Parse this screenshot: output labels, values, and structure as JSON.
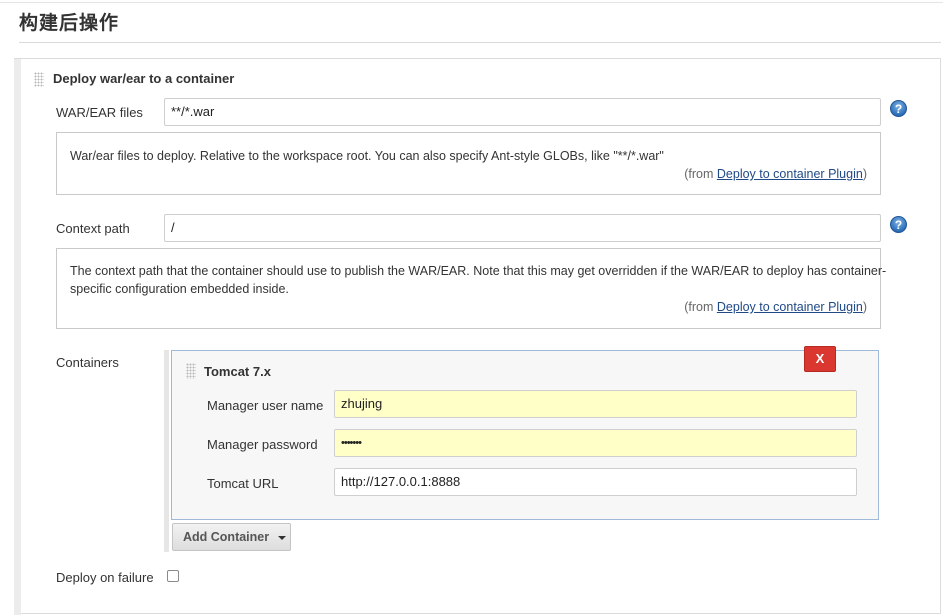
{
  "section": {
    "title": "构建后操作"
  },
  "deploy_block": {
    "title": "Deploy war/ear to a container",
    "war_files": {
      "label": "WAR/EAR files",
      "value": "**/*.war",
      "help_icon": "question-mark",
      "help_text": "War/ear files to deploy. Relative to the workspace root. You can also specify Ant-style GLOBs, like \"**/*.war\"",
      "from_prefix": "(from ",
      "plugin_link": "Deploy to container Plugin",
      "from_suffix": ")"
    },
    "context_path": {
      "label": "Context path",
      "value": "/",
      "help_icon": "question-mark",
      "help_text": "The context path that the container should use to publish the WAR/EAR. Note that this may get overridden if the WAR/EAR to deploy has container-specific configuration embedded inside.",
      "from_prefix": "(from ",
      "plugin_link": "Deploy to container Plugin",
      "from_suffix": ")"
    },
    "containers": {
      "label": "Containers",
      "delete_label": "X",
      "tomcat": {
        "title": "Tomcat 7.x",
        "user_label": "Manager user name",
        "user_value": "zhujing",
        "password_label": "Manager password",
        "password_value": "•••••••",
        "url_label": "Tomcat URL",
        "url_value": "http://127.0.0.1:8888"
      },
      "add_button_label": "Add Container"
    },
    "deploy_on_failure": {
      "label": "Deploy on failure",
      "checked": false
    }
  },
  "colors": {
    "link": "#204a87",
    "delete_button": "#d9372f",
    "highlight_field": "#ffffc7",
    "help_icon": "#2c6fb8"
  }
}
